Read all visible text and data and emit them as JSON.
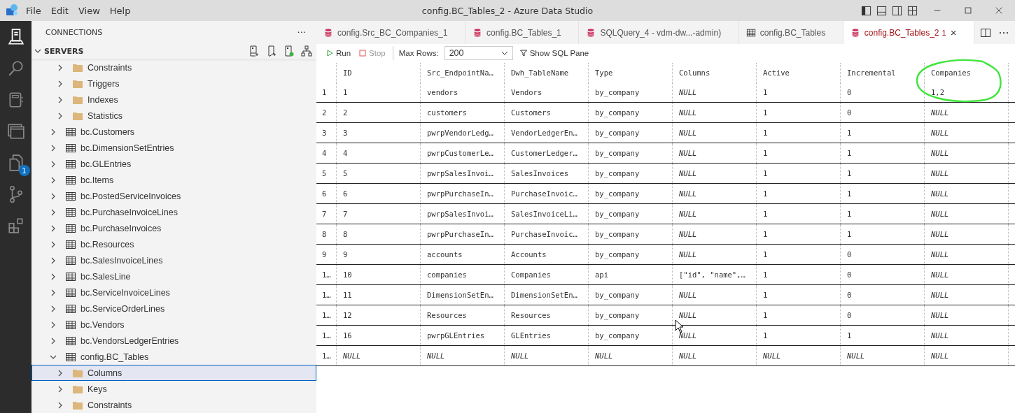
{
  "window": {
    "title": "config.BC_Tables_2 - Azure Data Studio",
    "menu": [
      "File",
      "Edit",
      "View",
      "Help"
    ]
  },
  "activity_bar": {
    "badge": "1"
  },
  "sidebar": {
    "title": "CONNECTIONS",
    "more": "···",
    "section": "SERVERS",
    "section_expanded": true,
    "tree": [
      {
        "children": [
          {
            "label": "Constraints",
            "kind": "folder",
            "expanded": false,
            "selected": false
          },
          {
            "label": "Triggers",
            "kind": "folder",
            "expanded": false,
            "selected": false
          },
          {
            "label": "Indexes",
            "kind": "folder",
            "expanded": false,
            "selected": false
          },
          {
            "label": "Statistics",
            "kind": "folder",
            "expanded": false,
            "selected": false
          }
        ]
      },
      {
        "label": "bc.Customers",
        "kind": "table",
        "expanded": false,
        "selected": false
      },
      {
        "label": "bc.DimensionSetEntries",
        "kind": "table",
        "expanded": false,
        "selected": false
      },
      {
        "label": "bc.GLEntries",
        "kind": "table",
        "expanded": false,
        "selected": false
      },
      {
        "label": "bc.Items",
        "kind": "table",
        "expanded": false,
        "selected": false
      },
      {
        "label": "bc.PostedServiceInvoices",
        "kind": "table",
        "expanded": false,
        "selected": false
      },
      {
        "label": "bc.PurchaseInvoiceLines",
        "kind": "table",
        "expanded": false,
        "selected": false
      },
      {
        "label": "bc.PurchaseInvoices",
        "kind": "table",
        "expanded": false,
        "selected": false
      },
      {
        "label": "bc.Resources",
        "kind": "table",
        "expanded": false,
        "selected": false
      },
      {
        "label": "bc.SalesInvoiceLines",
        "kind": "table",
        "expanded": false,
        "selected": false
      },
      {
        "label": "bc.SalesLine",
        "kind": "table",
        "expanded": false,
        "selected": false
      },
      {
        "label": "bc.ServiceInvoiceLines",
        "kind": "table",
        "expanded": false,
        "selected": false
      },
      {
        "label": "bc.ServiceOrderLines",
        "kind": "table",
        "expanded": false,
        "selected": false
      },
      {
        "label": "bc.Vendors",
        "kind": "table",
        "expanded": false,
        "selected": false
      },
      {
        "label": "bc.VendorsLedgerEntries",
        "kind": "table",
        "expanded": false,
        "selected": false
      },
      {
        "label": "config.BC_Tables",
        "kind": "table",
        "expanded": true,
        "selected": false,
        "children": [
          {
            "label": "Columns",
            "kind": "folder",
            "expanded": false,
            "selected": true
          },
          {
            "label": "Keys",
            "kind": "folder",
            "expanded": false,
            "selected": false
          },
          {
            "label": "Constraints",
            "kind": "folder",
            "expanded": false,
            "selected": false
          }
        ]
      }
    ]
  },
  "tabs": [
    {
      "label": "config.Src_BC_Companies_1",
      "kind": "query",
      "selected": false
    },
    {
      "label": "config.BC_Tables_1",
      "kind": "query",
      "selected": false
    },
    {
      "label": "SQLQuery_4 - vdm-dw...-admin)",
      "kind": "query",
      "selected": false
    },
    {
      "label": "config.BC_Tables",
      "kind": "table",
      "selected": false
    },
    {
      "label": "config.BC_Tables_2",
      "kind": "query",
      "selected": true,
      "badge": "1",
      "close": "×"
    }
  ],
  "toolbar": {
    "run": "Run",
    "stop": "Stop",
    "max_rows_label": "Max Rows:",
    "max_rows": "200",
    "sql_pane": "Show SQL Pane"
  },
  "table": {
    "columns": [
      "ID",
      "Src_EndpointNa…",
      "Dwh_TableName",
      "Type",
      "Columns",
      "Active",
      "Incremental",
      "Companies"
    ],
    "rows": [
      {
        "num": "1",
        "cells": [
          "1",
          "vendors",
          "Vendors",
          "by_company",
          {
            "v": "NULL",
            "null": true
          },
          "1",
          "0",
          "1,2"
        ]
      },
      {
        "num": "2",
        "cells": [
          "2",
          "customers",
          "Customers",
          "by_company",
          {
            "v": "NULL",
            "null": true
          },
          "1",
          "0",
          {
            "v": "NULL",
            "null": true
          }
        ]
      },
      {
        "num": "3",
        "cells": [
          "3",
          "pwrpVendorLedg…",
          "VendorLedgerEn…",
          "by_company",
          {
            "v": "NULL",
            "null": true
          },
          "1",
          "1",
          {
            "v": "NULL",
            "null": true
          }
        ]
      },
      {
        "num": "4",
        "cells": [
          "4",
          "pwrpCustomerLe…",
          "CustomerLedger…",
          "by_company",
          {
            "v": "NULL",
            "null": true
          },
          "1",
          "1",
          {
            "v": "NULL",
            "null": true
          }
        ]
      },
      {
        "num": "5",
        "cells": [
          "5",
          "pwrpSalesInvoi…",
          "SalesInvoices",
          "by_company",
          {
            "v": "NULL",
            "null": true
          },
          "1",
          "1",
          {
            "v": "NULL",
            "null": true
          }
        ]
      },
      {
        "num": "6",
        "cells": [
          "6",
          "pwrpPurchaseIn…",
          "PurchaseInvoic…",
          "by_company",
          {
            "v": "NULL",
            "null": true
          },
          "1",
          "1",
          {
            "v": "NULL",
            "null": true
          }
        ]
      },
      {
        "num": "7",
        "cells": [
          "7",
          "pwrpSalesInvoi…",
          "SalesInvoiceLi…",
          "by_company",
          {
            "v": "NULL",
            "null": true
          },
          "1",
          "1",
          {
            "v": "NULL",
            "null": true
          }
        ]
      },
      {
        "num": "8",
        "cells": [
          "8",
          "pwrpPurchaseIn…",
          "PurchaseInvoic…",
          "by_company",
          {
            "v": "NULL",
            "null": true
          },
          "1",
          "1",
          {
            "v": "NULL",
            "null": true
          }
        ]
      },
      {
        "num": "9",
        "cells": [
          "9",
          "accounts",
          "Accounts",
          "by_company",
          {
            "v": "NULL",
            "null": true
          },
          "1",
          "0",
          {
            "v": "NULL",
            "null": true
          }
        ]
      },
      {
        "num": "1…",
        "cells": [
          "10",
          "companies",
          "Companies",
          "api",
          "[\"id\", \"name\",…",
          "1",
          "0",
          {
            "v": "NULL",
            "null": true
          }
        ]
      },
      {
        "num": "1…",
        "cells": [
          "11",
          "DimensionSetEn…",
          "DimensionSetEn…",
          "by_company",
          {
            "v": "NULL",
            "null": true
          },
          "1",
          "0",
          {
            "v": "NULL",
            "null": true
          }
        ]
      },
      {
        "num": "1…",
        "cells": [
          "12",
          "Resources",
          "Resources",
          "by_company",
          {
            "v": "NULL",
            "null": true
          },
          "1",
          "0",
          {
            "v": "NULL",
            "null": true
          }
        ]
      },
      {
        "num": "1…",
        "cells": [
          "16",
          "pwrpGLEntries",
          "GLEntries",
          "by_company",
          {
            "v": "NULL",
            "null": true
          },
          "1",
          "1",
          {
            "v": "NULL",
            "null": true
          }
        ]
      },
      {
        "num": "1…",
        "cells": [
          {
            "v": "NULL",
            "null": true
          },
          {
            "v": "NULL",
            "null": true
          },
          {
            "v": "NULL",
            "null": true
          },
          {
            "v": "NULL",
            "null": true
          },
          {
            "v": "NULL",
            "null": true
          },
          {
            "v": "NULL",
            "null": true
          },
          {
            "v": "NULL",
            "null": true
          },
          {
            "v": "NULL",
            "null": true
          }
        ]
      }
    ]
  }
}
